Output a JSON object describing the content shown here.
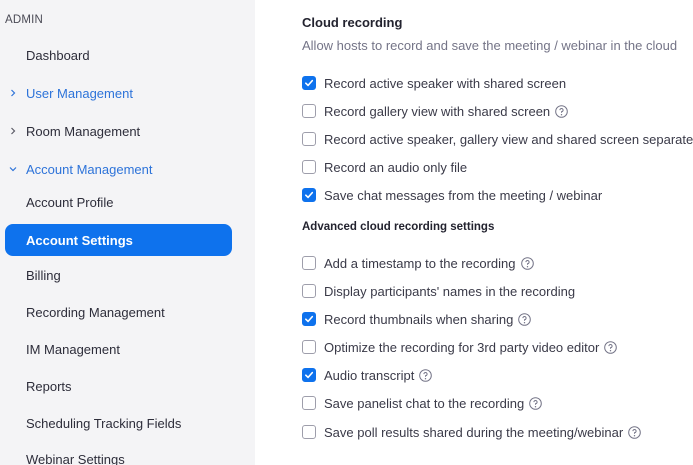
{
  "sidebar": {
    "heading": "ADMIN",
    "items": [
      {
        "label": "Dashboard",
        "state": "normal",
        "chevron": "none"
      },
      {
        "label": "User Management",
        "state": "blue",
        "chevron": "right"
      },
      {
        "label": "Room Management",
        "state": "normal",
        "chevron": "right"
      },
      {
        "label": "Account Management",
        "state": "blue",
        "chevron": "down"
      },
      {
        "label": "Account Profile",
        "state": "normal",
        "chevron": "none"
      },
      {
        "label": "Account Settings",
        "state": "active",
        "chevron": "none"
      },
      {
        "label": "Billing",
        "state": "normal",
        "chevron": "none"
      },
      {
        "label": "Recording Management",
        "state": "normal",
        "chevron": "none"
      },
      {
        "label": "IM Management",
        "state": "normal",
        "chevron": "none"
      },
      {
        "label": "Reports",
        "state": "normal",
        "chevron": "none"
      },
      {
        "label": "Scheduling Tracking Fields",
        "state": "normal",
        "chevron": "none"
      },
      {
        "label": "Webinar Settings",
        "state": "normal",
        "chevron": "none"
      }
    ]
  },
  "cloud_recording": {
    "title": "Cloud recording",
    "description": "Allow hosts to record and save the meeting / webinar in the cloud",
    "options": [
      {
        "label": "Record active speaker with shared screen",
        "checked": true,
        "help": false
      },
      {
        "label": "Record gallery view with shared screen",
        "checked": false,
        "help": true
      },
      {
        "label": "Record active speaker, gallery view and shared screen separately",
        "checked": false,
        "help": false
      },
      {
        "label": "Record an audio only file",
        "checked": false,
        "help": false
      },
      {
        "label": "Save chat messages from the meeting / webinar",
        "checked": true,
        "help": false
      }
    ]
  },
  "advanced": {
    "title": "Advanced cloud recording settings",
    "options": [
      {
        "label": "Add a timestamp to the recording",
        "checked": false,
        "help": true
      },
      {
        "label": "Display participants' names in the recording",
        "checked": false,
        "help": false
      },
      {
        "label": "Record thumbnails when sharing",
        "checked": true,
        "help": true
      },
      {
        "label": "Optimize the recording for 3rd party video editor",
        "checked": false,
        "help": true
      },
      {
        "label": "Audio transcript",
        "checked": true,
        "help": true
      },
      {
        "label": "Save panelist chat to the recording",
        "checked": false,
        "help": true
      },
      {
        "label": "Save poll results shared during the meeting/webinar",
        "checked": false,
        "help": true
      }
    ]
  },
  "colors": {
    "accent": "#0e72ed",
    "link_blue": "#2d73d9",
    "sidebar_bg": "#f4f4f6",
    "checkbox_border": "#9e9eab"
  }
}
